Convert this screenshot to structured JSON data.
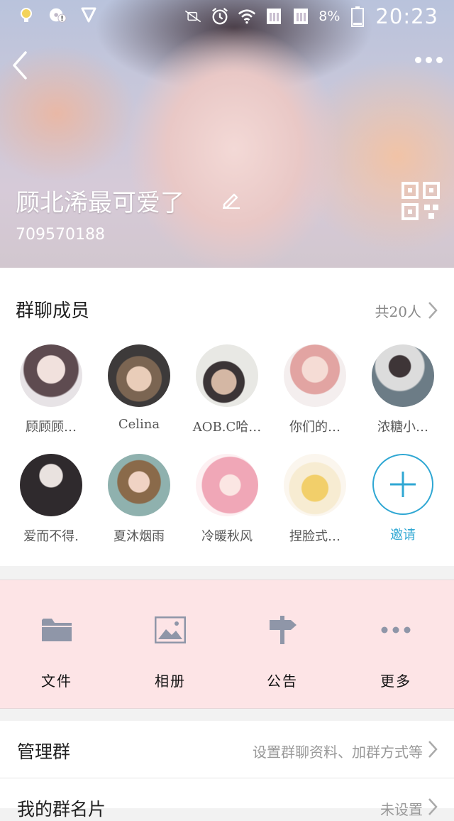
{
  "status_bar": {
    "battery": "8%",
    "time": "20:23",
    "left_icons": [
      "notification-bulb-icon",
      "disc-alert-icon",
      "shield-icon"
    ],
    "right_icons": [
      "mute-icon",
      "alarm-icon",
      "wifi-icon",
      "sim1-icon",
      "sim2-icon",
      "battery-icon"
    ]
  },
  "header": {
    "group_name": "顾北浠最可爱了",
    "group_id": "709570188"
  },
  "members": {
    "title": "群聊成员",
    "count": "共20人",
    "list": [
      {
        "name": "顾顾顾…",
        "color": "#7a6a72"
      },
      {
        "name": "Celina",
        "color": "#6b5a4c"
      },
      {
        "name": "AOB.C哈…",
        "color": "#8c8578"
      },
      {
        "name": "你们的…",
        "color": "#d7a9a8"
      },
      {
        "name": "浓糖小…",
        "color": "#7e8a96"
      },
      {
        "name": "爱而不得.",
        "color": "#3b3337"
      },
      {
        "name": "夏沐烟雨",
        "color": "#9a8262"
      },
      {
        "name": "冷暖秋风",
        "color": "#f3b7c4"
      },
      {
        "name": "捏脸式…",
        "color": "#f2d98a"
      }
    ],
    "invite_label": "邀请"
  },
  "actions": [
    {
      "label": "文件",
      "icon": "folder-icon"
    },
    {
      "label": "相册",
      "icon": "image-icon"
    },
    {
      "label": "公告",
      "icon": "signpost-icon"
    },
    {
      "label": "更多",
      "icon": "more-icon"
    }
  ],
  "settings": {
    "manage_title": "管理群",
    "manage_value": "设置群聊资料、加群方式等",
    "card_title": "我的群名片",
    "card_value": "未设置"
  },
  "colors": {
    "accent": "#2fa7d3",
    "actions_bg": "#fde4e6",
    "icon_gray": "#8f96a8"
  }
}
